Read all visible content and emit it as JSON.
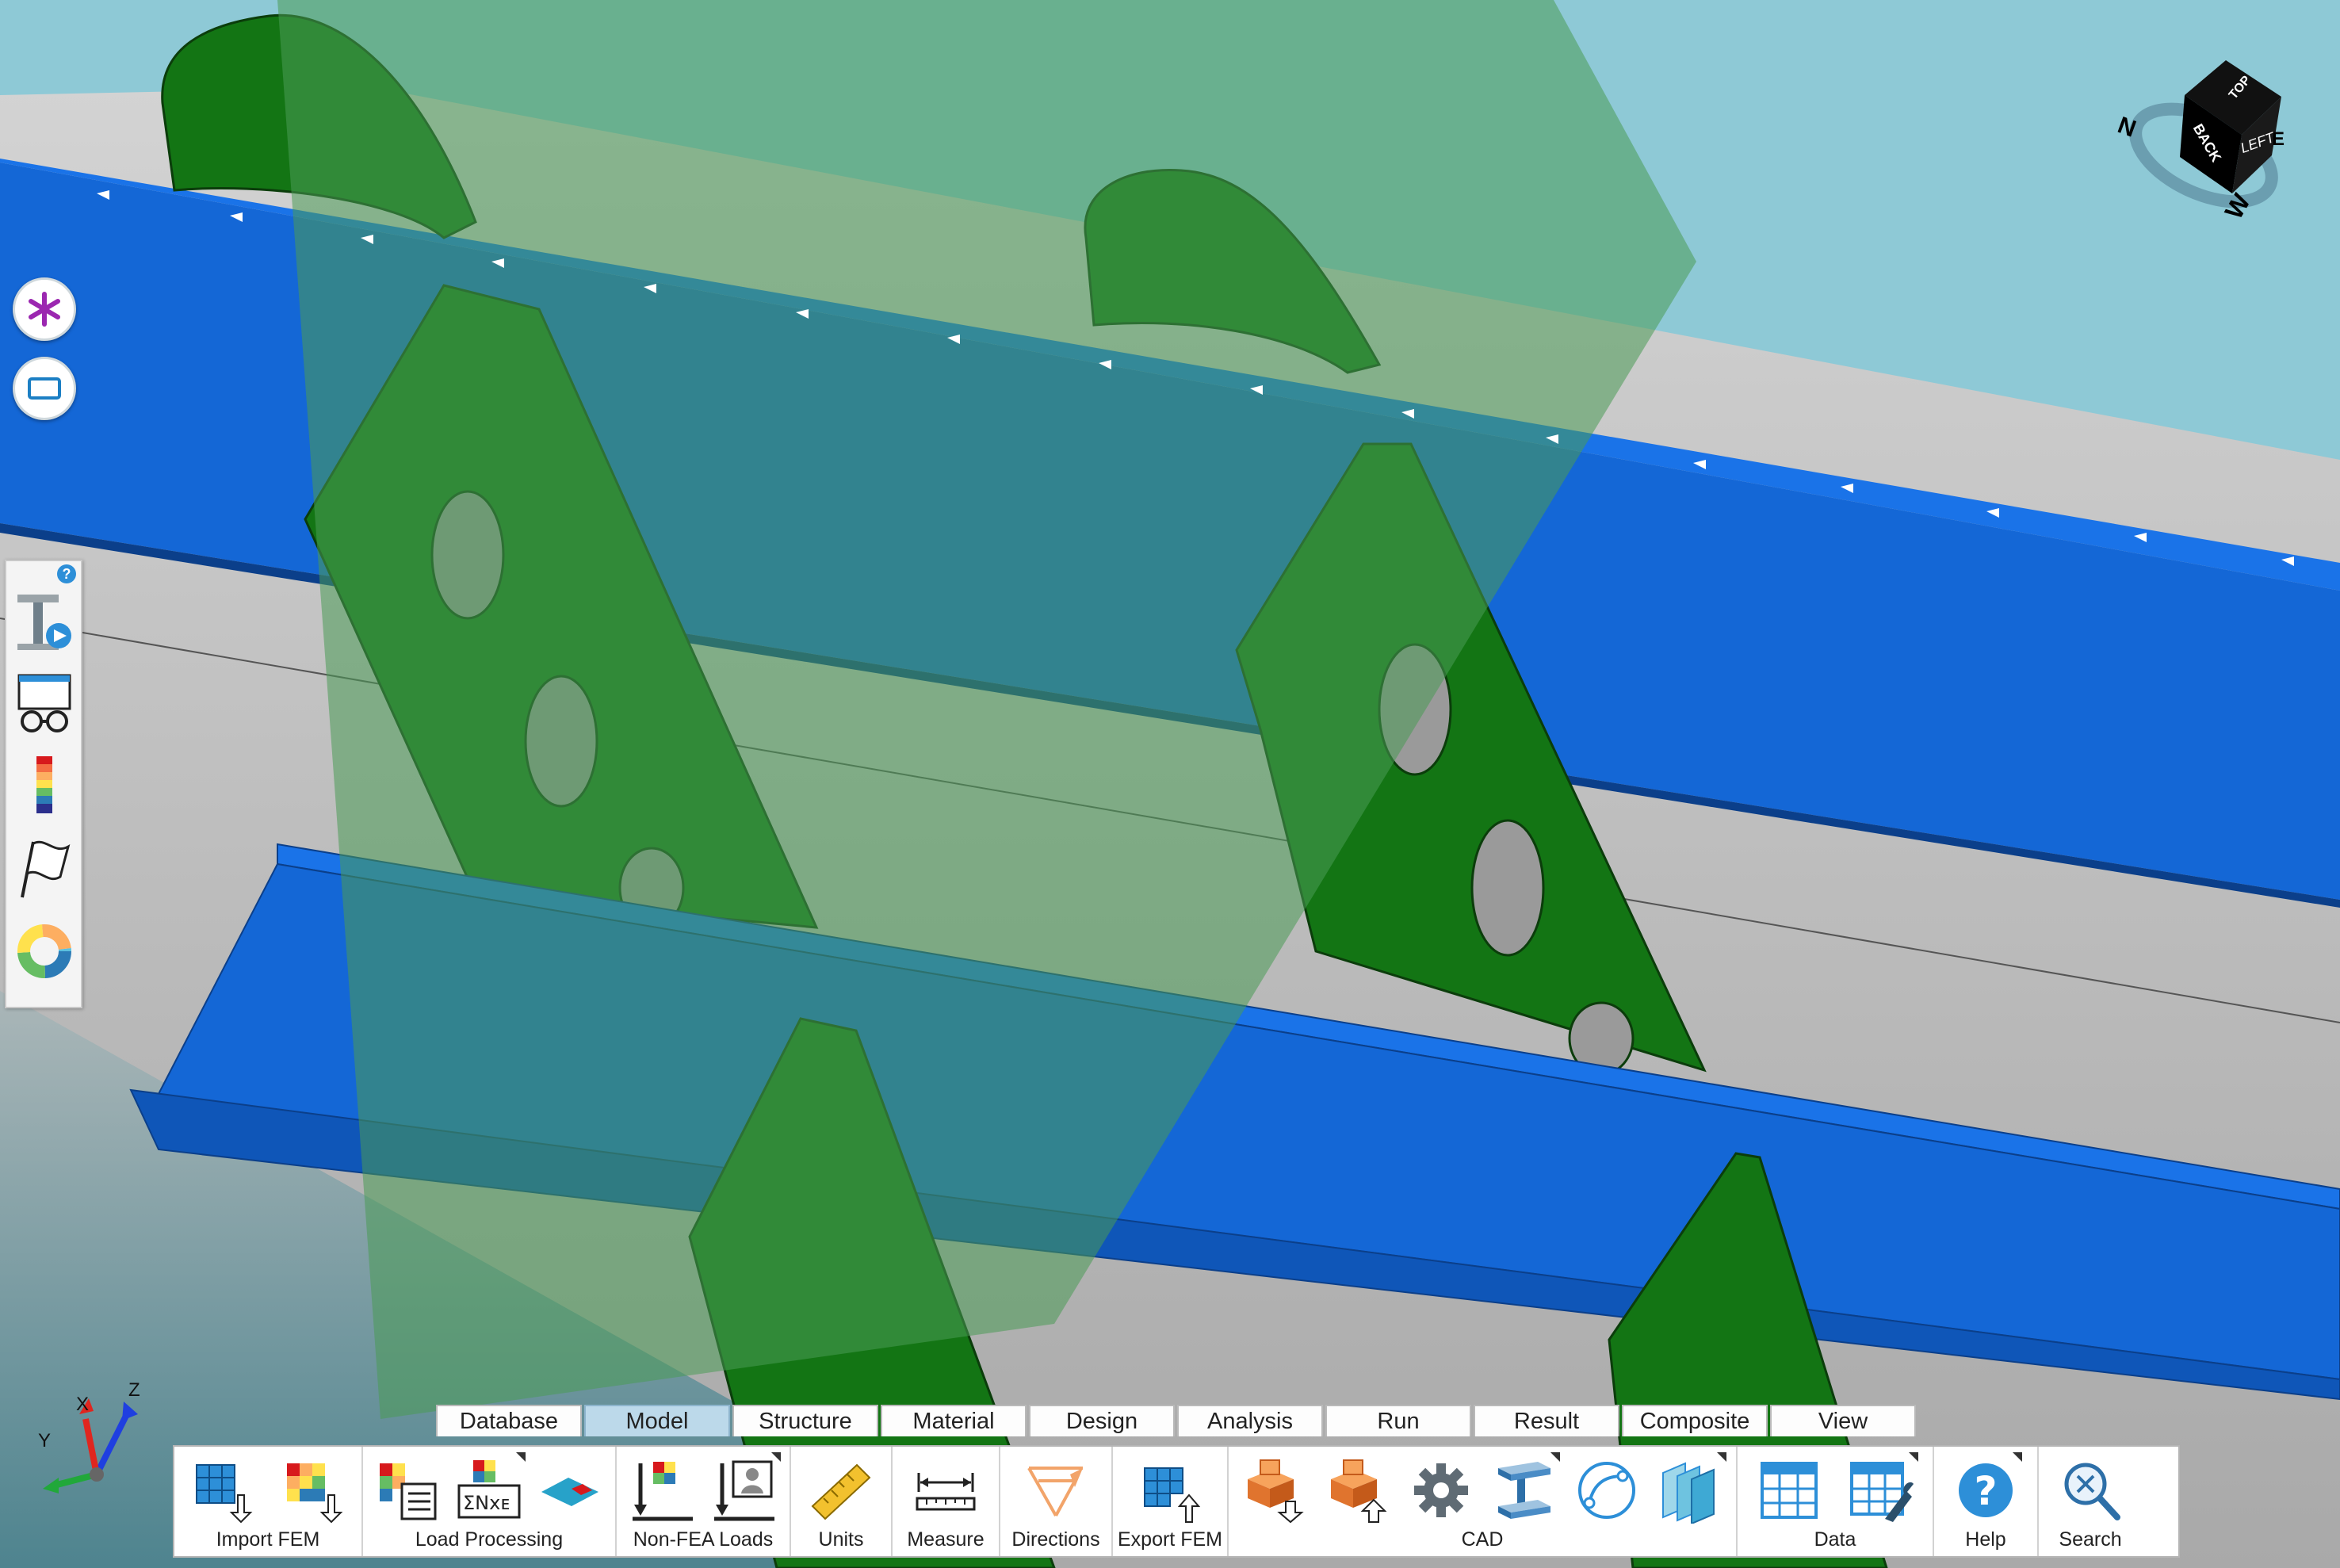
{
  "app": {
    "colors": {
      "sky": "#8ec9d6",
      "stringer_blue": "#1467d6",
      "rib_green": "#137514",
      "skin_grey": "#bcbcbc",
      "cut_plane": "#5fa06a"
    }
  },
  "left_buttons": [
    {
      "icon": "asterisk-icon"
    },
    {
      "icon": "rectangle-select-icon"
    }
  ],
  "left_toolstrip": {
    "help_icon": "?",
    "tools": [
      {
        "icon": "beam-play-icon"
      },
      {
        "icon": "glasses-view-icon"
      },
      {
        "icon": "color-legend-icon"
      },
      {
        "icon": "flag-icon"
      },
      {
        "icon": "donut-chart-icon"
      }
    ]
  },
  "nav_cube": {
    "faces": [
      "BACK",
      "LEFT",
      "TOP"
    ],
    "compass": [
      "N",
      "W",
      "E"
    ]
  },
  "triad": {
    "x": "X",
    "y": "Y",
    "z": "Z"
  },
  "tabs": [
    {
      "label": "Database"
    },
    {
      "label": "Model",
      "active": true
    },
    {
      "label": "Structure"
    },
    {
      "label": "Material"
    },
    {
      "label": "Design"
    },
    {
      "label": "Analysis"
    },
    {
      "label": "Run"
    },
    {
      "label": "Result"
    },
    {
      "label": "Composite"
    },
    {
      "label": "View"
    }
  ],
  "ribbon": {
    "groups": [
      {
        "label": "Import FEM",
        "icons": [
          "import-fem-mesh-icon",
          "import-fem-colored-icon"
        ]
      },
      {
        "label": "Load Processing",
        "icons": [
          "load-table-icon",
          "load-sum-icon",
          "load-plate-icon"
        ]
      },
      {
        "label": "Non-FEA Loads",
        "icons": [
          "non-fea-load-icon",
          "non-fea-person-icon"
        ]
      },
      {
        "label": "Units",
        "icons": [
          "ruler-icon"
        ]
      },
      {
        "label": "Measure",
        "icons": [
          "measure-icon"
        ]
      },
      {
        "label": "Directions",
        "icons": [
          "directions-icon"
        ]
      },
      {
        "label": "Export FEM",
        "icons": [
          "export-fem-icon"
        ]
      },
      {
        "label": "CAD",
        "icons": [
          "cad-import-icon",
          "cad-export-icon",
          "gear-icon",
          "i-beam-icon",
          "curve-icon",
          "planes-icon"
        ]
      },
      {
        "label": "Data",
        "icons": [
          "data-grid-icon",
          "data-edit-icon"
        ]
      },
      {
        "label": "Help",
        "icons": [
          "help-icon"
        ]
      },
      {
        "label": "Search",
        "icons": [
          "search-icon"
        ]
      }
    ]
  }
}
